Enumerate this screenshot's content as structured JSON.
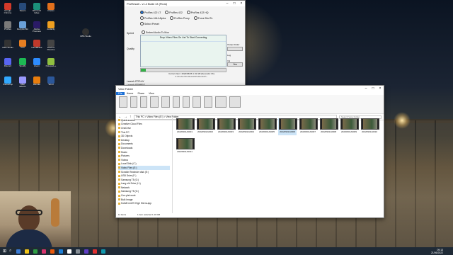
{
  "desktop_icons": [
    {
      "label": "Google Chrome",
      "color": "#d23a2a"
    },
    {
      "label": "Steam",
      "color": "#274a7a"
    },
    {
      "label": "Microsoft Edge",
      "color": "#1b8f7a"
    },
    {
      "label": "Firefox",
      "color": "#e2701c"
    },
    {
      "label": "ProRes",
      "color": "#7a7a7a"
    },
    {
      "label": "Recycle Bin",
      "color": "#6aa0d8"
    },
    {
      "label": "Adobe Premiere",
      "color": "#2a1a66"
    },
    {
      "label": "Audacity",
      "color": "#f0a020"
    },
    {
      "label": "OBS Studio",
      "color": "#333333"
    },
    {
      "label": "VLC",
      "color": "#e67e22"
    },
    {
      "label": "HandBrake",
      "color": "#c0392b"
    },
    {
      "label": "DaVinci Resolve",
      "color": "#444444"
    },
    {
      "label": "Discord",
      "color": "#5865f2"
    },
    {
      "label": "Spotify",
      "color": "#1db954"
    },
    {
      "label": "Zoom",
      "color": "#2d8cff"
    },
    {
      "label": "Notepad++",
      "color": "#90c040"
    },
    {
      "label": "Photoshop",
      "color": "#31a8ff"
    },
    {
      "label": "After Effects",
      "color": "#9999ff"
    },
    {
      "label": "Blender",
      "color": "#e87d0d"
    },
    {
      "label": "Word",
      "color": "#2b579a"
    }
  ],
  "desktop_icon_extra": {
    "label": "OBS Studio",
    "color": "#303030"
  },
  "prores_window": {
    "title": "ProResAll - v1.4 Build 13 (Final)",
    "options": [
      "ProRes 422 LT",
      "ProRes 422",
      "ProRes 422 HQ",
      "ProRes 4444 Alpha",
      "ProRes Proxy",
      "Force Dist To",
      "Select Preset"
    ],
    "option_selected": 0,
    "preset_value": "Copy",
    "check_label": "Embed Audio To Mov",
    "sidebar_labels": [
      "Speed",
      "Quality"
    ],
    "drop_text": "Drop Video Files On List To Start Converting",
    "progress": 0.06,
    "status_line1": "Current Item: 2022/06/06 1.01 GB (Seconds: 0h)",
    "status_line2": "C:\\Drobox\\ProResAll\\ProRes422\\...",
    "launch_labels": [
      "Launch FFPLAY",
      "Launch FFMPEG"
    ],
    "right_labels": [
      "Output folder",
      "Log",
      "Vol"
    ],
    "right_value": "Yes"
  },
  "explorer": {
    "title": "View Folder",
    "ribbon_tabs": [
      "File",
      "Home",
      "Share",
      "View"
    ],
    "address": "This PC > Video Files (E:) > View Folder",
    "search_placeholder": "Search View Folder",
    "tree": [
      "Quick access",
      "Creative Cloud Files",
      "OneDrive",
      "This PC",
      "3D Objects",
      "Desktop",
      "Documents",
      "Downloads",
      "Music",
      "Pictures",
      "Videos",
      "Local Disk (C:)",
      "Video Files (E:)",
      "Scratch Rewinder disk (E:)",
      "USB Drive (F:)",
      "Samsung T5 (G:)",
      "Lang old Drive (H:)",
      "Network",
      "Samsung T5 (G:)",
      "Con-plet-work",
      "Bulk Image",
      "Kofafil mnt70 High Sierra.app"
    ],
    "tree_selected": 12,
    "files": [
      "20220901A0001",
      "20220901A0002",
      "20220901A0003",
      "20220901A0004",
      "20220901A0005",
      "20220901A0006",
      "20220901A0007",
      "20220901A0008",
      "20220901A0009",
      "20220901A0010",
      "20220901A0011"
    ],
    "status_left": "11 items",
    "status_right": "1 item selected  1.10 GB"
  },
  "taskbar": {
    "search_icon": "search-icon",
    "time": "09:13",
    "date": "21/06/2022"
  },
  "colors": {
    "accent": "#1a6fd6",
    "taskbar": "#1f2a36",
    "prores_bg": "#e9f4ef"
  }
}
